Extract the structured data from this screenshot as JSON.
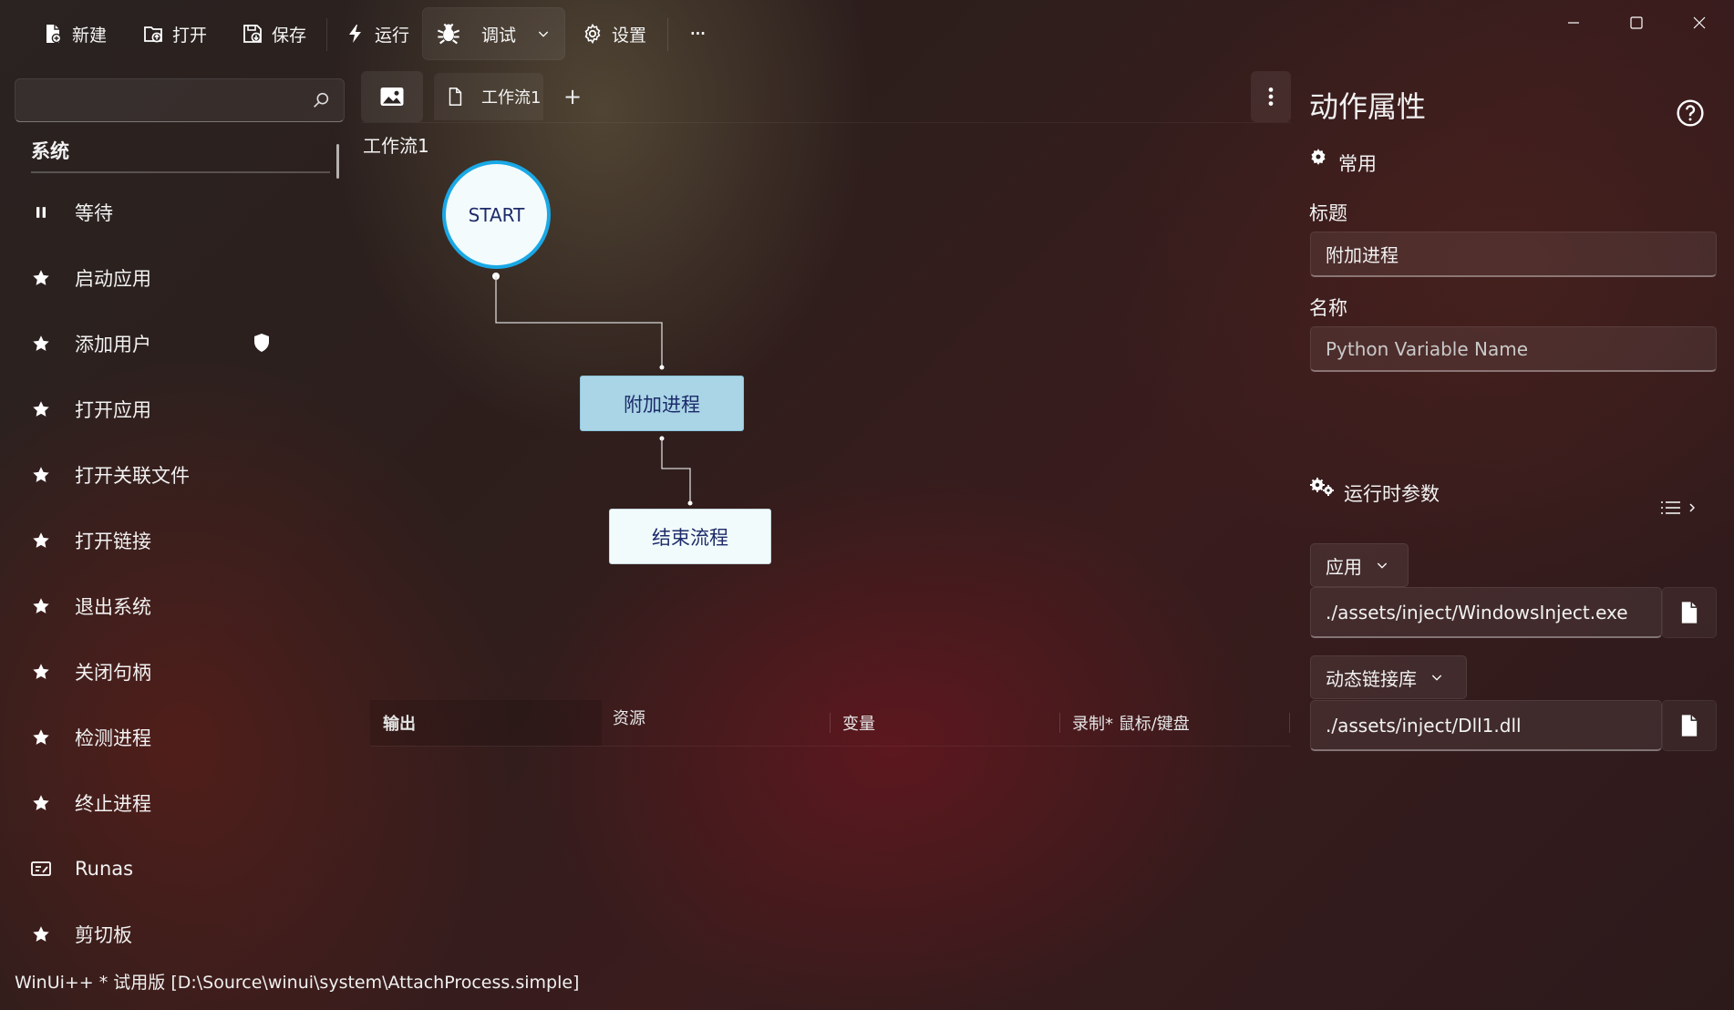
{
  "toolbar": {
    "new_label": "新建",
    "open_label": "打开",
    "save_label": "保存",
    "run_label": "运行",
    "debug_label": "调试",
    "settings_label": "设置",
    "more_label": "···"
  },
  "sidebar": {
    "search_placeholder": "",
    "section_title": "系统",
    "items": [
      {
        "label": "等待",
        "icon": "pause-icon"
      },
      {
        "label": "启动应用",
        "icon": "star-icon"
      },
      {
        "label": "添加用户",
        "icon": "star-icon",
        "badge": "shield-icon"
      },
      {
        "label": "打开应用",
        "icon": "star-icon"
      },
      {
        "label": "打开关联文件",
        "icon": "star-icon"
      },
      {
        "label": "打开链接",
        "icon": "star-icon"
      },
      {
        "label": "退出系统",
        "icon": "star-icon"
      },
      {
        "label": "关闭句柄",
        "icon": "star-icon"
      },
      {
        "label": "检测进程",
        "icon": "star-icon"
      },
      {
        "label": "终止进程",
        "icon": "star-icon"
      },
      {
        "label": "Runas",
        "icon": "runas-icon"
      },
      {
        "label": "剪切板",
        "icon": "star-icon"
      }
    ]
  },
  "canvas": {
    "tab_label": "工作流1",
    "add_tab": "+",
    "workflow_title": "工作流1",
    "nodes": {
      "start": "START",
      "attach": "附加进程",
      "end": "结束流程"
    }
  },
  "output_panel": {
    "tabs": [
      "输出",
      "资源",
      "变量",
      "录制* 鼠标/键盘"
    ]
  },
  "properties": {
    "title": "动作属性",
    "common_section": "常用",
    "title_label": "标题",
    "title_value": "附加进程",
    "name_label": "名称",
    "name_placeholder": "Python Variable Name",
    "runtime_section": "运行时参数",
    "app_combo": "应用",
    "app_path": "./assets/inject/WindowsInject.exe",
    "dll_combo": "动态链接库",
    "dll_path": "./assets/inject/Dll1.dll"
  },
  "status_bar": {
    "text": "WinUi++ * 试用版 [D:\\Source\\winui\\system\\AttachProcess.simple]"
  },
  "colors": {
    "accent_blue": "#1aa8e6",
    "node_selected": "#a9d5e6",
    "node_text": "#1d2b6a"
  }
}
